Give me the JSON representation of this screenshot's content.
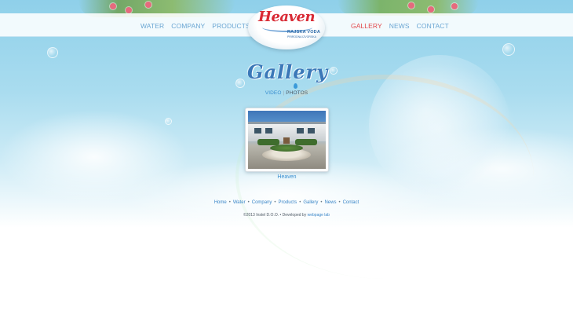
{
  "header": {
    "nav_left": [
      {
        "label": "WATER",
        "active": false
      },
      {
        "label": "COMPANY",
        "active": false
      },
      {
        "label": "PRODUCTS",
        "active": false
      }
    ],
    "nav_right": [
      {
        "label": "GALLERY",
        "active": true
      },
      {
        "label": "NEWS",
        "active": false
      },
      {
        "label": "CONTACT",
        "active": false
      }
    ],
    "logo": {
      "script": "Heaven",
      "line1": "RAJSKA VODA",
      "line2": "PRIRODNA IZVORSKA"
    }
  },
  "main": {
    "title": "Gallery",
    "subnav": {
      "video": "VIDEO",
      "separator": "|",
      "photos": "PHOTOS"
    },
    "albums": [
      {
        "caption": "Heaven"
      }
    ]
  },
  "footer": {
    "links": [
      "Home",
      "Water",
      "Company",
      "Products",
      "Gallery",
      "News",
      "Contact"
    ],
    "copyright_prefix": "©2013 Instel D.O.O. • Developed by",
    "developer": "webpage lab"
  },
  "colors": {
    "accent": "#3a8fd0",
    "nav": "#6aa6d3",
    "active": "#e2484b",
    "brand_red": "#d92b35"
  },
  "icons": [
    "water-drop-icon"
  ]
}
